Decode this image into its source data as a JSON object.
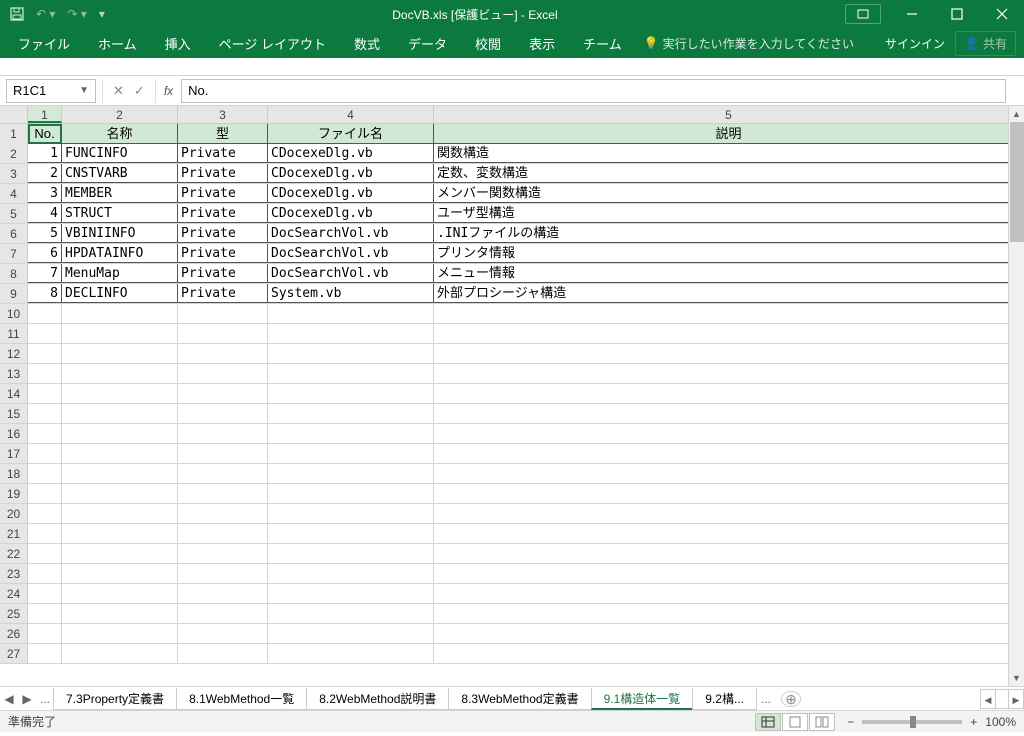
{
  "window": {
    "title": "DocVB.xls [保護ビュー] - Excel"
  },
  "ribbon": {
    "tabs": [
      "ファイル",
      "ホーム",
      "挿入",
      "ページ レイアウト",
      "数式",
      "データ",
      "校閲",
      "表示",
      "チーム"
    ],
    "tellme": "実行したい作業を入力してください",
    "signin": "サインイン",
    "share": "共有"
  },
  "formula": {
    "namebox": "R1C1",
    "fx": "fx",
    "value": "No."
  },
  "columns": [
    "1",
    "2",
    "3",
    "4",
    "5"
  ],
  "headers": {
    "no": "No.",
    "name": "名称",
    "type": "型",
    "file": "ファイル名",
    "desc": "説明"
  },
  "rows": [
    {
      "no": "1",
      "name": "FUNCINFO",
      "type": "Private",
      "file": "CDocexeDlg.vb",
      "desc": "関数構造"
    },
    {
      "no": "2",
      "name": "CNSTVARB",
      "type": "Private",
      "file": "CDocexeDlg.vb",
      "desc": "定数、変数構造"
    },
    {
      "no": "3",
      "name": "MEMBER",
      "type": "Private",
      "file": "CDocexeDlg.vb",
      "desc": "メンバー関数構造"
    },
    {
      "no": "4",
      "name": "STRUCT",
      "type": "Private",
      "file": "CDocexeDlg.vb",
      "desc": "ユーザ型構造"
    },
    {
      "no": "5",
      "name": "VBINIINFO",
      "type": "Private",
      "file": "DocSearchVol.vb",
      "desc": ".INIファイルの構造"
    },
    {
      "no": "6",
      "name": "HPDATAINFO",
      "type": "Private",
      "file": "DocSearchVol.vb",
      "desc": "プリンタ情報"
    },
    {
      "no": "7",
      "name": "MenuMap",
      "type": "Private",
      "file": "DocSearchVol.vb",
      "desc": "メニュー情報"
    },
    {
      "no": "8",
      "name": "DECLINFO",
      "type": "Private",
      "file": "System.vb",
      "desc": "外部プロシージャ構造"
    }
  ],
  "emptyRowCount": 18,
  "sheets": {
    "tabs": [
      "7.3Property定義書",
      "8.1WebMethod一覧",
      "8.2WebMethod説明書",
      "8.3WebMethod定義書",
      "9.1構造体一覧",
      "9.2構..."
    ],
    "active": 4,
    "dots": "..."
  },
  "status": {
    "text": "準備完了",
    "zoom": "100%"
  }
}
